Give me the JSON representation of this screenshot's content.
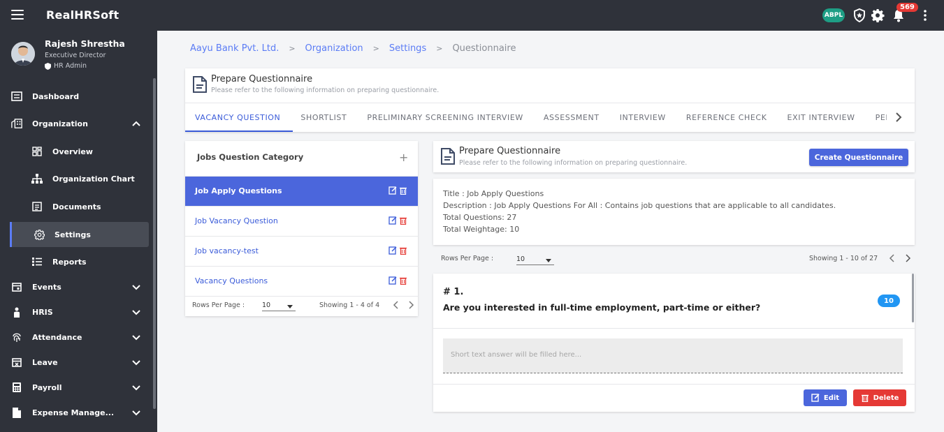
{
  "app": {
    "title": "RealHRSoft",
    "org_badge": "ABPL",
    "notification_count": "569"
  },
  "profile": {
    "name": "Rajesh Shrestha",
    "role": "Executive Director",
    "access": "HR Admin"
  },
  "nav": {
    "dashboard": "Dashboard",
    "organization": "Organization",
    "overview": "Overview",
    "org_chart": "Organization Chart",
    "documents": "Documents",
    "settings": "Settings",
    "reports": "Reports",
    "events": "Events",
    "hris": "HRIS",
    "attendance": "Attendance",
    "leave": "Leave",
    "payroll": "Payroll",
    "expense": "Expense Manage..."
  },
  "breadcrumb": [
    "Aayu Bank Pvt. Ltd.",
    "Organization",
    "Settings",
    "Questionnaire"
  ],
  "header": {
    "title": "Prepare Questionnaire",
    "subtitle": "Please refer to the following information on preparing questionnaire."
  },
  "tabs": [
    "VACANCY QUESTION",
    "SHORTLIST",
    "PRELIMINARY SCREENING INTERVIEW",
    "ASSESSMENT",
    "INTERVIEW",
    "REFERENCE CHECK",
    "EXIT INTERVIEW",
    "PERF"
  ],
  "categories": {
    "title": "Jobs Question Category",
    "add_symbol": "+",
    "items": [
      "Job Apply Questions",
      "Job Vacancy Question",
      "Job vacancy-test",
      "Vacancy Questions"
    ],
    "rows_per_page_label": "Rows Per Page :",
    "rows_per_page": "10",
    "showing": "Showing 1 - 4 of 4"
  },
  "questionnaire": {
    "title": "Prepare Questionnaire",
    "subtitle": "Please refer to the following information on preparing questionnaire.",
    "create_button": "Create Questionnaire",
    "info_title": "Title : Job Apply Questions",
    "info_description": "Description : Job Apply Questions For All : Contains job questions that are applicable to all candidates.",
    "info_total_questions": "Total Questions: 27",
    "info_total_weightage": "Total Weightage: 10",
    "rows_per_page_label": "Rows Per Page :",
    "rows_per_page": "10",
    "showing": "Showing 1 - 10 of 27"
  },
  "question": {
    "number": "# 1.",
    "text": "Are you interested in full-time employment, part-time or either?",
    "weight": "10",
    "answer_placeholder": "Short text answer will be filled here...",
    "edit_label": "Edit",
    "delete_label": "Delete"
  },
  "colors": {
    "primary": "#4b66dc",
    "danger": "#e53935",
    "sidebar": "#2f323a",
    "badge": "#1e9e85",
    "weight_badge": "#2196f3"
  }
}
